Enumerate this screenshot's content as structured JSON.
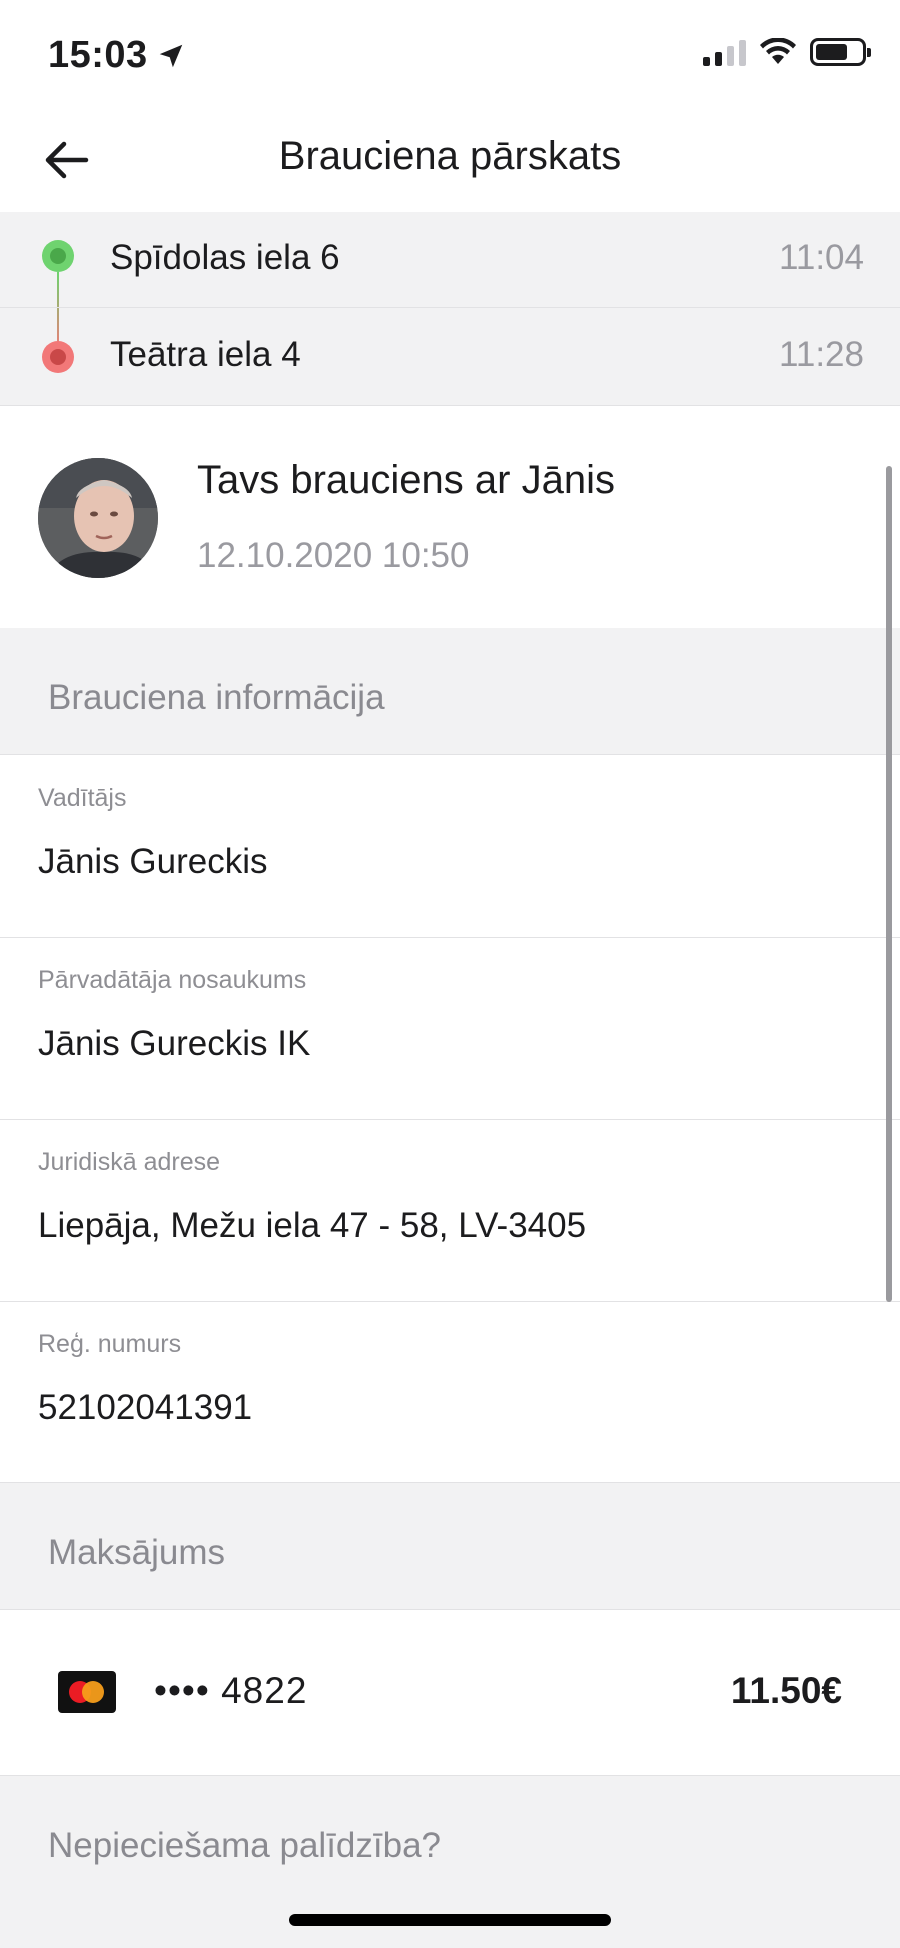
{
  "status_bar": {
    "time": "15:03",
    "icons": [
      "location-arrow-icon",
      "signal-icon",
      "wifi-icon",
      "battery-icon"
    ]
  },
  "nav": {
    "title": "Brauciena pārskats",
    "back_icon": "arrow-left-icon"
  },
  "route": {
    "pickup": {
      "address": "Spīdolas iela 6",
      "time": "11:04"
    },
    "dropoff": {
      "address": "Teātra iela 4",
      "time": "11:28"
    }
  },
  "trip": {
    "title": "Tavs brauciens ar Jānis",
    "datetime": "12.10.2020 10:50"
  },
  "info_section": {
    "title": "Brauciena informācija",
    "rows": [
      {
        "label": "Vadītājs",
        "value": "Jānis Gureckis"
      },
      {
        "label": "Pārvadātāja nosaukums",
        "value": "Jānis Gureckis IK"
      },
      {
        "label": "Juridiskā adrese",
        "value": "Liepāja, Mežu iela 47 - 58, LV-3405"
      },
      {
        "label": "Reģ. numurs",
        "value": "52102041391"
      }
    ]
  },
  "payment_section": {
    "title": "Maksājums",
    "card_icon": "mastercard-icon",
    "card_number": "•••• 4822",
    "amount": "11.50€"
  },
  "help_section": {
    "title": "Nepieciešama palīdzība?"
  },
  "colors": {
    "pickup": "#6fd36f",
    "dropoff": "#f27878",
    "section_bg": "#f2f2f3"
  }
}
